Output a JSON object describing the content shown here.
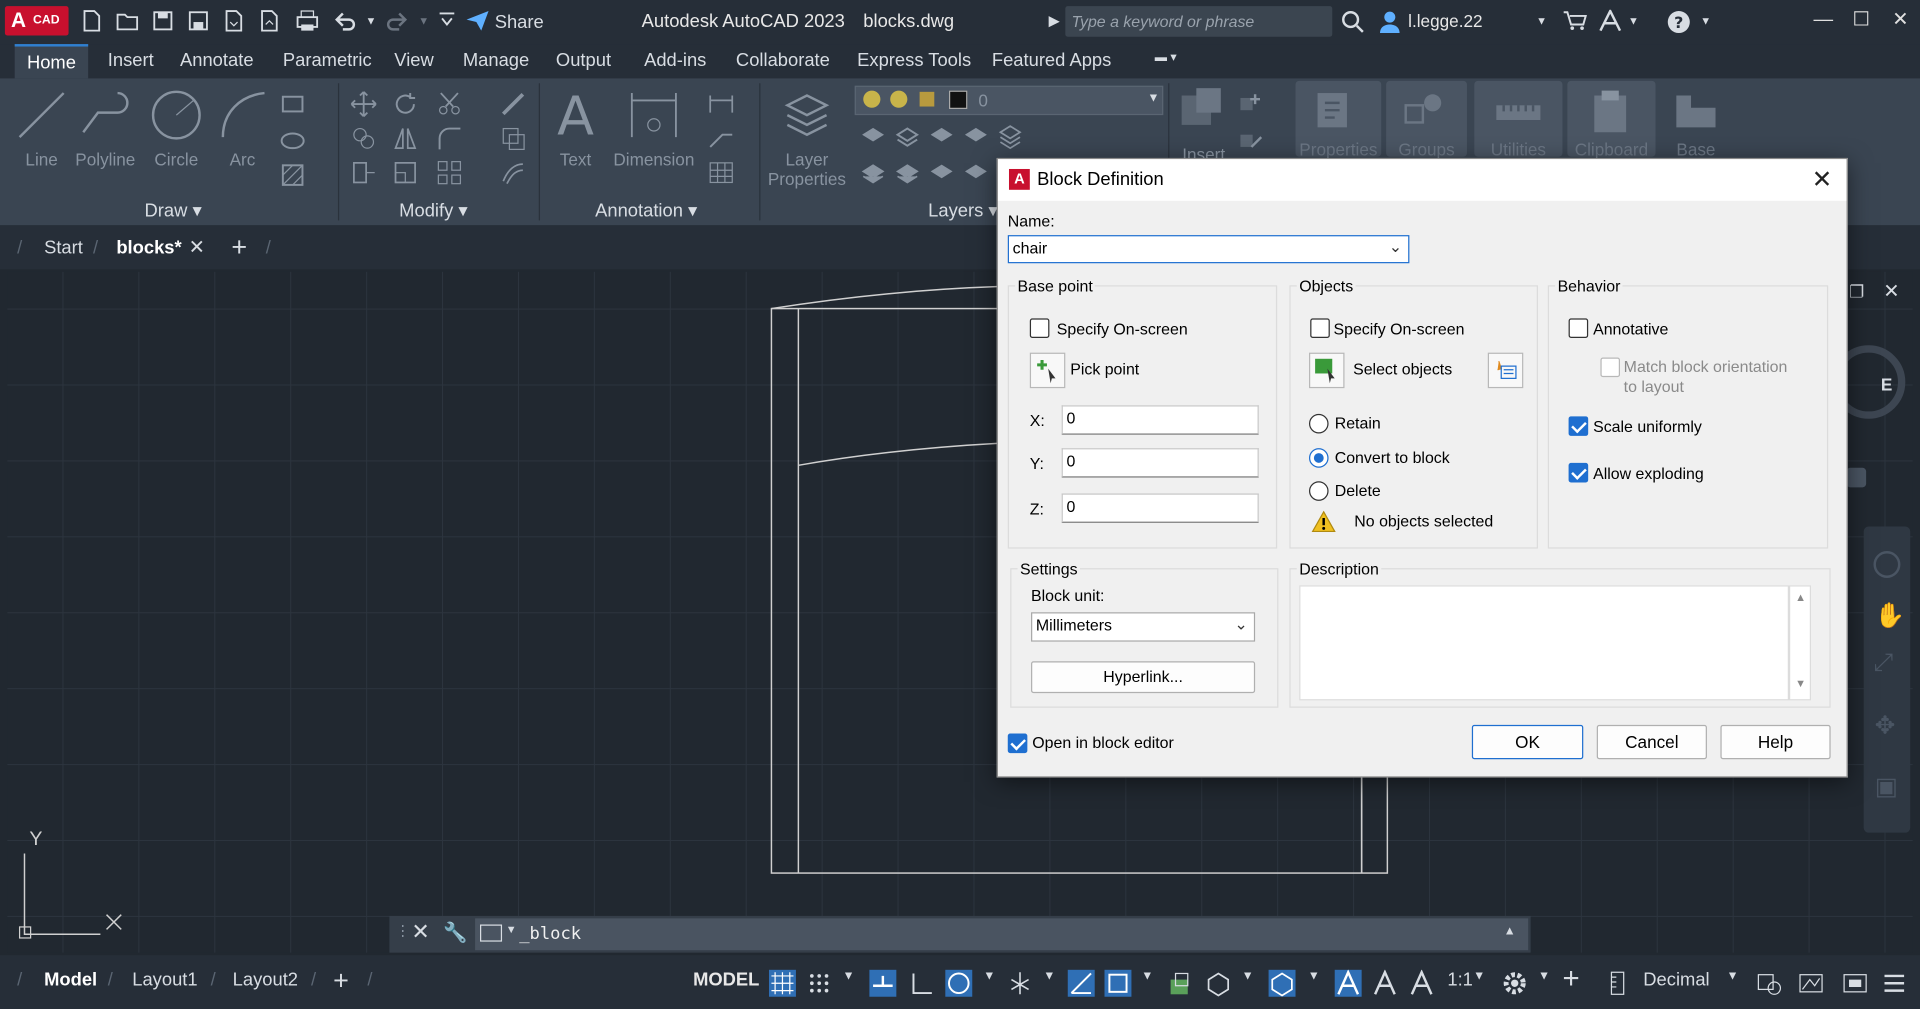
{
  "app": {
    "logo_letter": "A",
    "logo_sub": "CAD",
    "title": "Autodesk AutoCAD 2023",
    "filename": "blocks.dwg",
    "share_label": "Share",
    "search_placeholder": "Type a keyword or phrase",
    "user": "l.legge.22"
  },
  "ribbon_tabs": [
    "Home",
    "Insert",
    "Annotate",
    "Parametric",
    "View",
    "Manage",
    "Output",
    "Add-ins",
    "Collaborate",
    "Express Tools",
    "Featured Apps"
  ],
  "ribbon": {
    "draw_buttons": [
      "Line",
      "Polyline",
      "Circle",
      "Arc"
    ],
    "annotation_buttons": [
      "Text",
      "Dimension"
    ],
    "layer_properties": "Layer Properties",
    "layer_value": "0",
    "right_buttons": [
      "Insert",
      "Properties",
      "Groups",
      "Utilities",
      "Clipboard",
      "Base"
    ],
    "panel_titles": {
      "draw": "Draw",
      "modify": "Modify",
      "annotation": "Annotation",
      "layers": "Layers"
    }
  },
  "doc_tabs": [
    "Start",
    "blocks*"
  ],
  "command_line": {
    "text": "_block"
  },
  "status": {
    "layout_tabs": [
      "Model",
      "Layout1",
      "Layout2"
    ],
    "model_label": "MODEL",
    "scale": "1:1",
    "units": "Decimal"
  },
  "axis": {
    "y_label": "Y",
    "x_label": "X"
  },
  "dialog": {
    "title": "Block Definition",
    "name_label": "Name:",
    "name_value": "chair",
    "base_point": {
      "title": "Base point",
      "specify_onscreen": "Specify On-screen",
      "pick_point": "Pick point",
      "x_label": "X:",
      "x_value": "0",
      "y_label": "Y:",
      "y_value": "0",
      "z_label": "Z:",
      "z_value": "0"
    },
    "objects": {
      "title": "Objects",
      "specify_onscreen": "Specify On-screen",
      "select_objects": "Select objects",
      "retain": "Retain",
      "convert": "Convert to block",
      "delete": "Delete",
      "status": "No objects selected"
    },
    "behavior": {
      "title": "Behavior",
      "annotative": "Annotative",
      "match_orientation_line1": "Match block orientation",
      "match_orientation_line2": "to layout",
      "scale_uniformly": "Scale uniformly",
      "allow_exploding": "Allow exploding"
    },
    "settings": {
      "title": "Settings",
      "block_unit_label": "Block unit:",
      "block_unit_value": "Millimeters",
      "hyperlink": "Hyperlink..."
    },
    "description": {
      "title": "Description",
      "value": ""
    },
    "open_in_editor": "Open in block editor",
    "ok": "OK",
    "cancel": "Cancel",
    "help": "Help"
  },
  "colors": {
    "accent": "#1f6fd0",
    "brand_red": "#c8102e"
  }
}
